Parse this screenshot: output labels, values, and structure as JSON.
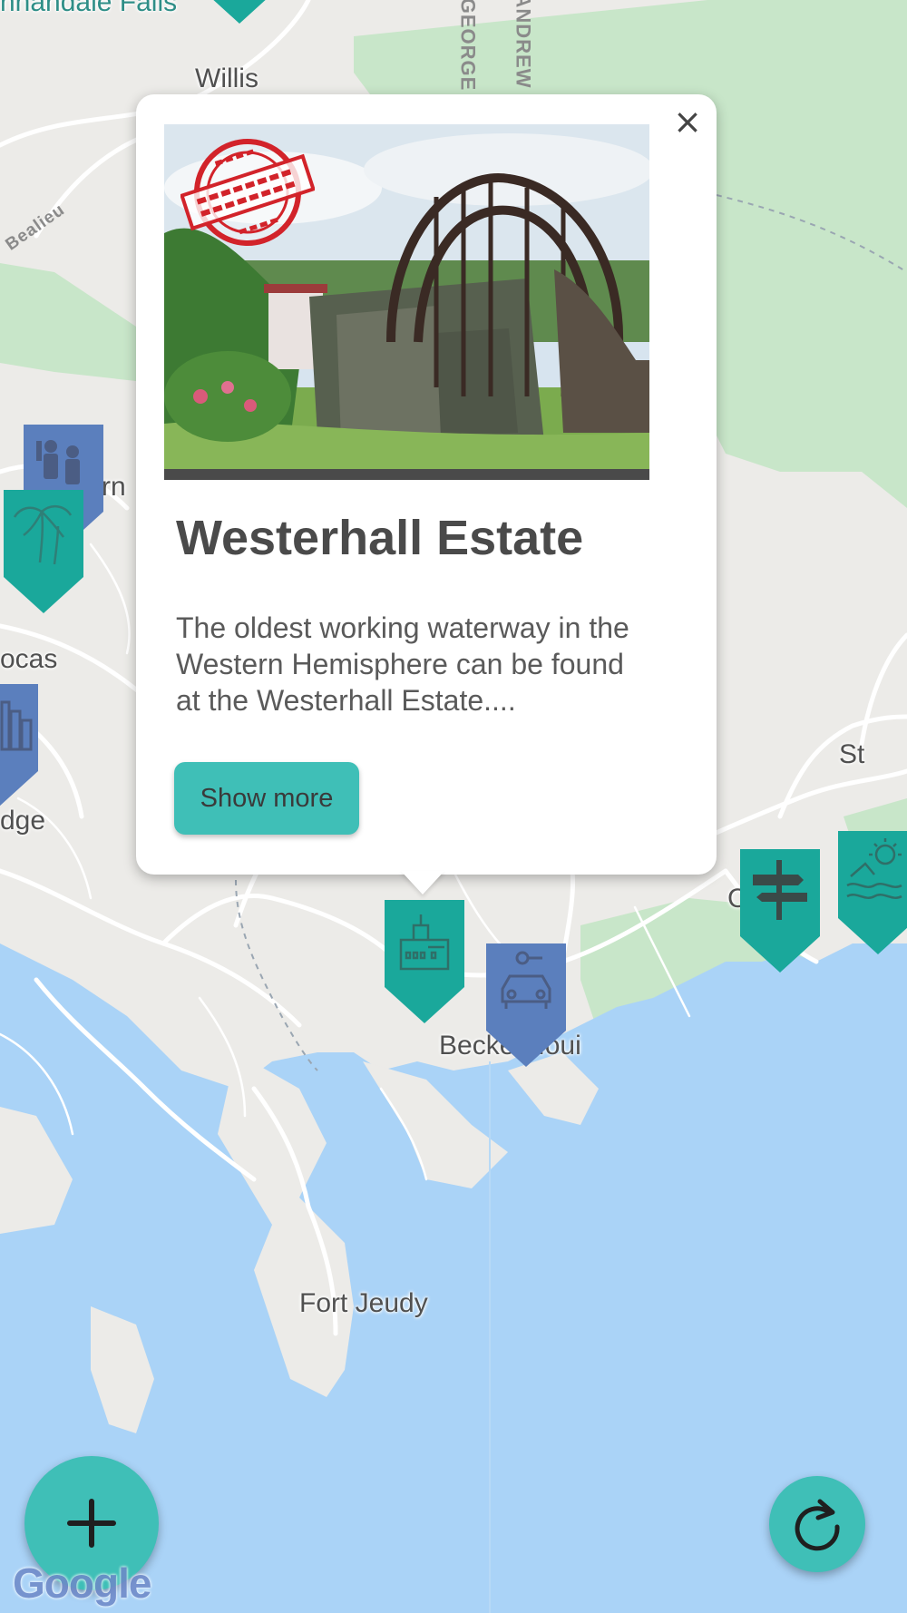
{
  "map": {
    "places": {
      "falls_fragment": "nnandale Falls",
      "willis": "Willis",
      "ocas": "ocas",
      "dge": "dge",
      "rn": "rn",
      "st": "St",
      "becke_moui": "Becke Moui",
      "fort_jeudy": "Fort Jeudy",
      "c_n": "C      n"
    },
    "roads": {
      "george": "GEORGE",
      "andrew": "ANDREW",
      "bealieu": "Bealieu"
    },
    "colors": {
      "land": "#ecebe8",
      "park": "#c8e6c9",
      "water": "#aad3f7",
      "road": "#ffffff",
      "marker_teal": "#1aa89b",
      "marker_blue": "#5b7fbd"
    },
    "attribution": "Google"
  },
  "markers": [
    {
      "id": "historic-building",
      "icon": "historic-building-icon",
      "color": "#1aa89b"
    },
    {
      "id": "car-rental",
      "icon": "car-rental-icon",
      "color": "#5b7fbd"
    },
    {
      "id": "people",
      "icon": "people-icon",
      "color": "#5b7fbd"
    },
    {
      "id": "nature",
      "icon": "palm-tree-icon",
      "color": "#1aa89b"
    },
    {
      "id": "city",
      "icon": "city-icon",
      "color": "#5b7fbd"
    },
    {
      "id": "signpost",
      "icon": "signpost-icon",
      "color": "#1aa89b"
    },
    {
      "id": "beach",
      "icon": "beach-icon",
      "color": "#1aa89b"
    },
    {
      "id": "top",
      "icon": "marker-icon",
      "color": "#1aa89b"
    }
  ],
  "popup": {
    "title": "Westerhall Estate",
    "description": "The oldest working waterway in the Western Hemisphere can be found at the Westerhall Estate....",
    "button_label": "Show more",
    "close_icon": "×",
    "stamp_text": "GRENADA HISTORICAL BUILDING AGENT"
  },
  "fabs": {
    "add_icon": "plus-icon",
    "refresh_icon": "refresh-icon"
  }
}
